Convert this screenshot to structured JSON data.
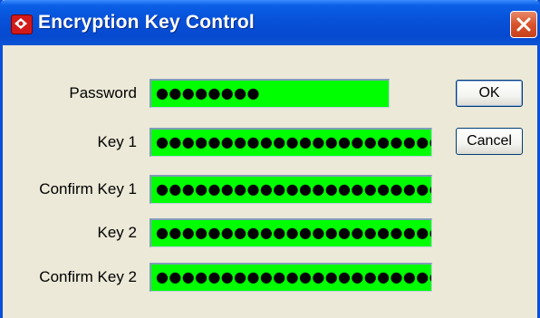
{
  "window": {
    "title": "Encryption Key Control"
  },
  "form": {
    "password_label": "Password",
    "password_value": "●●●●●●●●",
    "key1_label": "Key 1",
    "key1_value": "●●●●●●●●●●●●●●●●●●●●●●●●",
    "confirm_key1_label": "Confirm Key 1",
    "confirm_key1_value": "●●●●●●●●●●●●●●●●●●●●●●●●",
    "key2_label": "Key 2",
    "key2_value": "●●●●●●●●●●●●●●●●●●●●●●●●",
    "confirm_key2_label": "Confirm Key 2",
    "confirm_key2_value": "●●●●●●●●●●●●●●●●●●●●●●●●"
  },
  "buttons": {
    "ok_label": "OK",
    "cancel_label": "Cancel"
  },
  "colors": {
    "field_background": "#00ff00",
    "titlebar": "#0751d8",
    "window_background": "#ece9d8"
  }
}
